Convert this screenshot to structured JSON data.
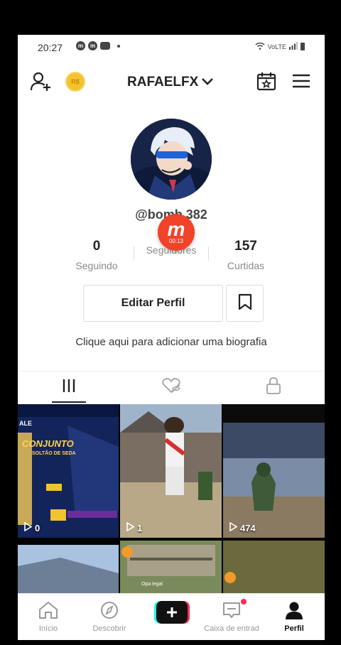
{
  "status_bar": {
    "time": "20:27",
    "network": "VoLTE"
  },
  "header": {
    "username": "RAFAELFX",
    "coin_label": "R$"
  },
  "profile": {
    "handle": "@bomb 382",
    "stats": [
      {
        "value": "0",
        "label": "Seguindo"
      },
      {
        "value": "",
        "label": "Seguidores"
      },
      {
        "value": "157",
        "label": "Curtidas"
      }
    ],
    "edit_label": "Editar Perfil",
    "bio_prompt": "Clique aqui para adicionar uma biografia"
  },
  "recorder_overlay": {
    "logo": "m",
    "timer": "00:13"
  },
  "videos": [
    {
      "views": "0",
      "overlay_text_1": "CONJUNTO",
      "overlay_text_2": "SOLTÃO DE SEDA",
      "badge": "ALE"
    },
    {
      "views": "1"
    },
    {
      "views": "474"
    },
    {
      "views": ""
    },
    {
      "views": "",
      "caption": "Opa legal"
    },
    {
      "views": ""
    }
  ],
  "bottom_nav": [
    {
      "label": "Início",
      "icon": "home-icon"
    },
    {
      "label": "Descobrir",
      "icon": "compass-icon"
    },
    {
      "label": "",
      "icon": "plus-icon"
    },
    {
      "label": "Caixa de entrad",
      "icon": "inbox-icon"
    },
    {
      "label": "Perfil",
      "icon": "profile-icon"
    }
  ],
  "colors": {
    "accent_red": "#fe2c55",
    "accent_cyan": "#25f4ee",
    "coin": "#f2c32f",
    "recorder": "#f0432a"
  }
}
